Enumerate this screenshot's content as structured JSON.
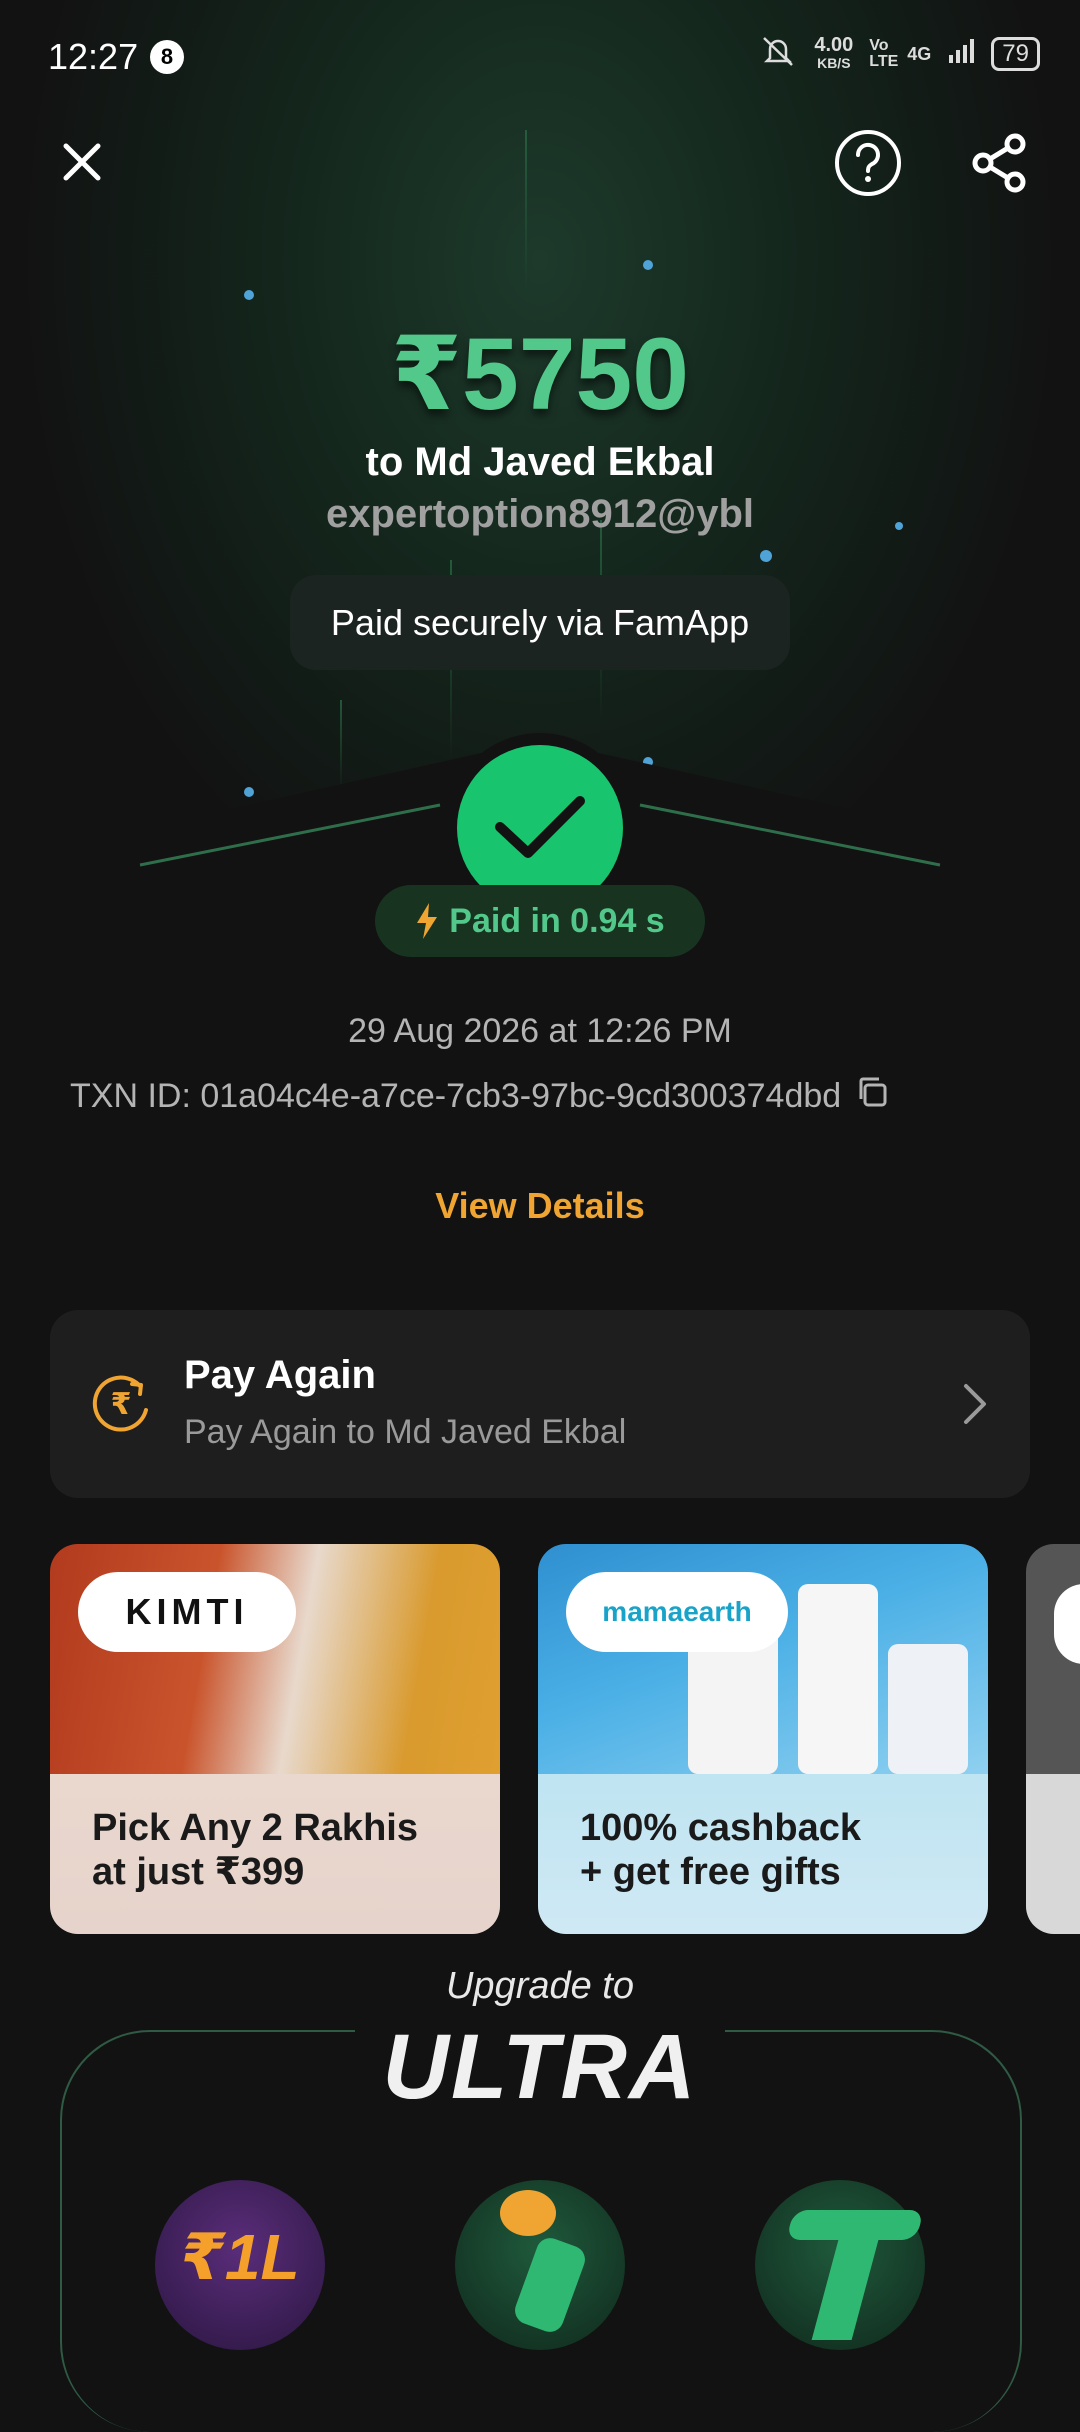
{
  "status_bar": {
    "time": "12:27",
    "notification_count": "8",
    "net_speed_value": "4.00",
    "net_speed_unit": "KB/S",
    "volte": "Vo LTE",
    "network": "4G",
    "battery": "79"
  },
  "payment": {
    "amount": "₹5750",
    "to_line": "to Md Javed Ekbal",
    "upi_id": "expertoption8912@ybl",
    "paid_via": "Paid securely via FamApp",
    "speed_label": "Paid in 0.94 s",
    "date_time": "29 Aug 2026 at 12:26 PM",
    "txn_id": "TXN ID: 01a04c4e-a7ce-7cb3-97bc-9cd300374dbd",
    "view_details": "View Details"
  },
  "pay_again": {
    "title": "Pay Again",
    "subtitle": "Pay Again to Md Javed Ekbal"
  },
  "promos": [
    {
      "brand": "KIMTI",
      "caption_line1": "Pick Any 2 Rakhis",
      "caption_line2": "at just ₹399"
    },
    {
      "brand": "mamaearth",
      "caption_line1": "100% cashback",
      "caption_line2": "+ get free gifts"
    }
  ],
  "ultra": {
    "upgrade_label": "Upgrade to",
    "title": "ULTRA",
    "perk_badge": "₹1L"
  },
  "colors": {
    "accent_green": "#52c98a",
    "check_green": "#19c46e",
    "link_orange": "#f0a431",
    "background": "#121212"
  }
}
